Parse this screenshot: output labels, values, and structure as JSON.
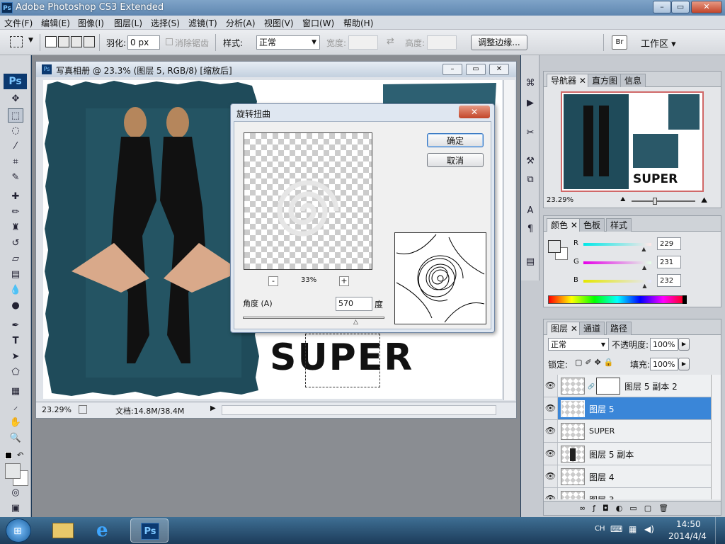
{
  "window": {
    "title": "Adobe Photoshop CS3 Extended",
    "app_icon": "Ps",
    "min": "–",
    "max": "▭",
    "close": "✕"
  },
  "menu": [
    "文件(F)",
    "编辑(E)",
    "图像(I)",
    "图层(L)",
    "选择(S)",
    "滤镜(T)",
    "分析(A)",
    "视图(V)",
    "窗口(W)",
    "帮助(H)"
  ],
  "options": {
    "feather_label": "羽化:",
    "feather_value": "0 px",
    "antialias_label": "消除锯齿",
    "style_label": "样式:",
    "style_value": "正常",
    "width_label": "宽度:",
    "height_label": "高度:",
    "refine_button": "调整边缘...",
    "workspace_label": "工作区 ▾"
  },
  "document": {
    "title": "写真相册 @ 23.3% (图层 5, RGB/8) [缩放后]",
    "zoom": "23.29%",
    "doc_info": "文档:14.8M/38.4M",
    "canvas_text": "SUPER"
  },
  "dialog": {
    "title": "旋转扭曲",
    "ok": "确定",
    "cancel": "取消",
    "zoom_out": "-",
    "zoom_in": "+",
    "preview_zoom": "33%",
    "angle_label": "角度 (A)",
    "angle_value": "570",
    "angle_unit": "度",
    "angle_slider": 0.8
  },
  "navigator": {
    "tabs": [
      "导航器",
      "直方图",
      "信息"
    ],
    "zoom": "23.29%",
    "thumb_text": "SUPER"
  },
  "color": {
    "tabs": [
      "颜色",
      "色板",
      "样式"
    ],
    "channels": [
      {
        "label": "R",
        "value": "229",
        "fill": 0.898
      },
      {
        "label": "G",
        "value": "231",
        "fill": 0.906
      },
      {
        "label": "B",
        "value": "232",
        "fill": 0.91
      }
    ]
  },
  "layers": {
    "tabs": [
      "图层",
      "通道",
      "路径"
    ],
    "blend_mode": "正常",
    "opacity_label": "不透明度:",
    "opacity_value": "100%",
    "lock_label": "锁定:",
    "fill_label": "填充:",
    "fill_value": "100%",
    "items": [
      {
        "name": "图层 5 副本 2"
      },
      {
        "name": "图层 5"
      },
      {
        "name": "SUPER"
      },
      {
        "name": "图层 5 副本"
      },
      {
        "name": "图层 4"
      },
      {
        "name": "图层 3"
      }
    ]
  },
  "taskbar": {
    "lang": "CH",
    "time": "14:50",
    "date": "2014/4/4"
  },
  "colors": {
    "accent": "#3a86d8",
    "teal_bg": "#1f4b5a"
  }
}
